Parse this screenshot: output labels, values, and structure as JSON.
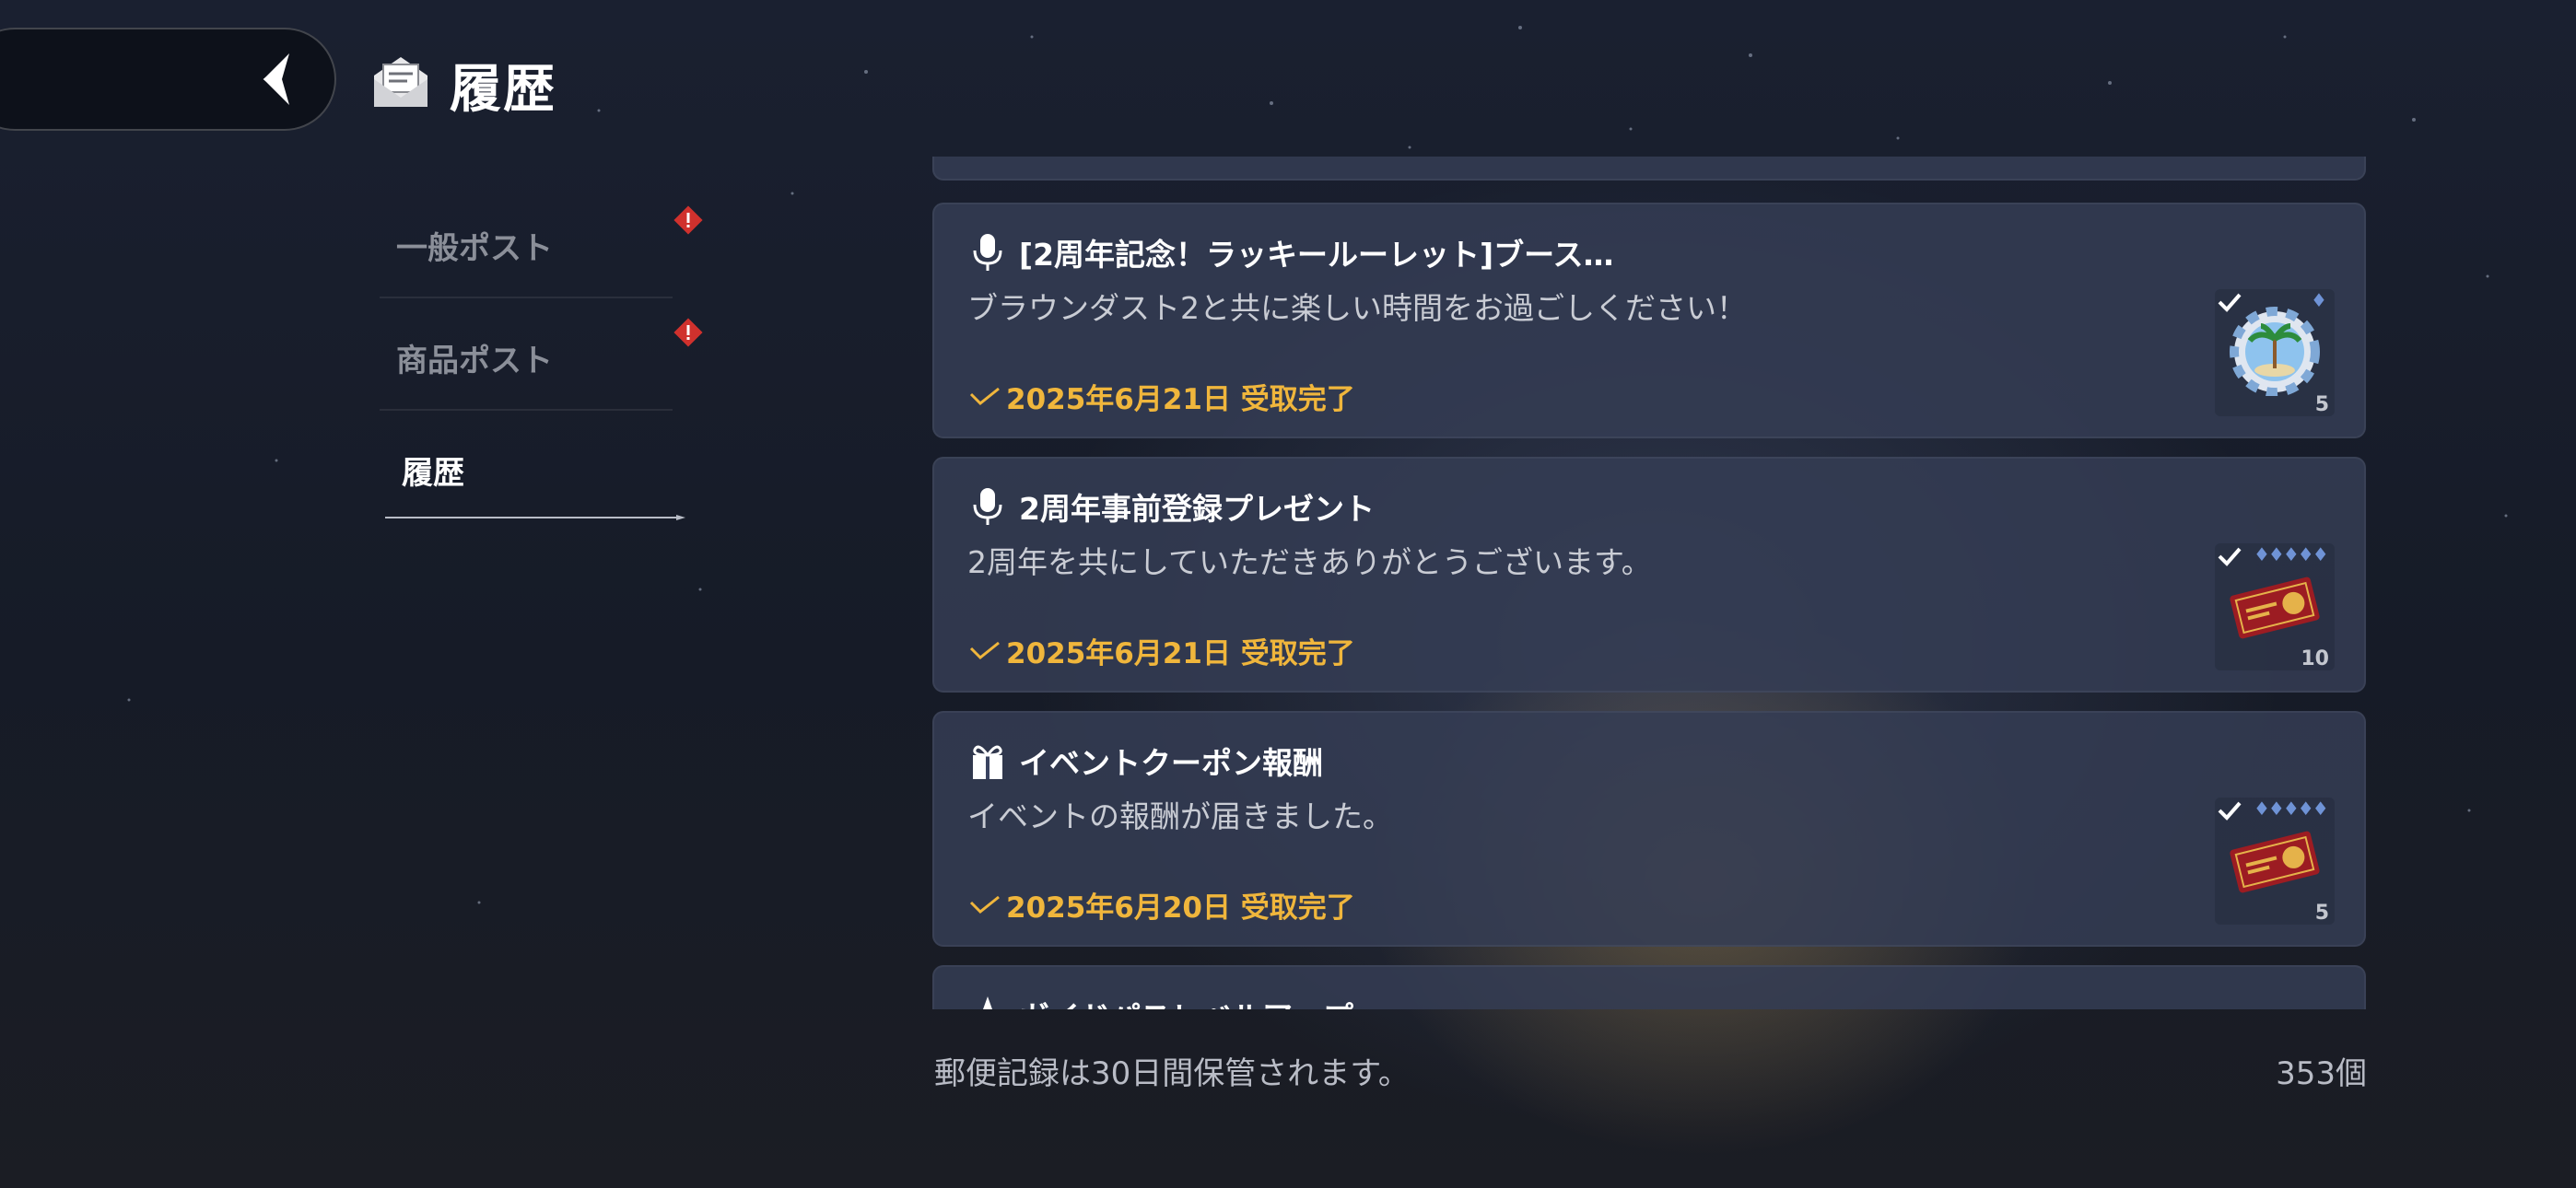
{
  "header": {
    "title": "履歴",
    "back_icon": "chevron-left-icon",
    "title_icon": "mail-icon"
  },
  "sidebar": {
    "tabs": [
      {
        "label": "一般ポスト",
        "has_alert": true
      },
      {
        "label": "商品ポスト",
        "has_alert": true
      },
      {
        "label": "履歴",
        "active": true
      }
    ]
  },
  "mails": [
    {
      "icon": "microphone-icon",
      "title": "[2周年記念！ラッキールーレット]ブース…",
      "body": "ブラウンダスト2と共に楽しい時間をお過ごしください！",
      "date": "2025年6月21日 受取完了",
      "reward": {
        "icon": "beach-token-icon",
        "count": "5",
        "gems": "♦"
      }
    },
    {
      "icon": "microphone-icon",
      "title": "2周年事前登録プレゼント",
      "body": "2周年を共にしていただきありがとうございます。",
      "date": "2025年6月21日 受取完了",
      "reward": {
        "icon": "summon-ticket-icon",
        "count": "10",
        "gems": "♦♦♦♦♦"
      }
    },
    {
      "icon": "gift-icon",
      "title": "イベントクーポン報酬",
      "body": "イベントの報酬が届きました。",
      "date": "2025年6月20日 受取完了",
      "reward": {
        "icon": "summon-ticket-icon",
        "count": "5",
        "gems": "♦♦♦♦♦"
      }
    },
    {
      "icon": "star-icon",
      "title": "ガイドパスレベルアップ",
      "body": "",
      "date": "",
      "reward": null
    }
  ],
  "footer": {
    "note": "郵便記録は30日間保管されます。",
    "count": "353個"
  },
  "colors": {
    "accent_gold": "#f0b63c",
    "alert_red": "#d0312d",
    "card_bg": "#343c54"
  }
}
